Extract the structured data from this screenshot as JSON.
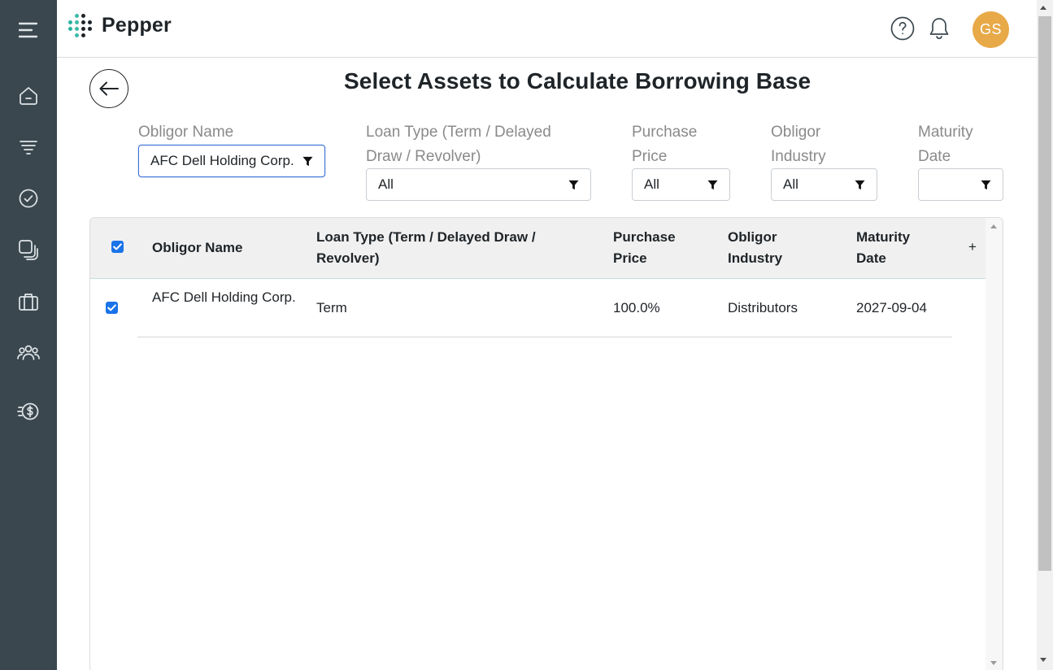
{
  "app": {
    "name": "Pepper",
    "logo_colors": [
      "#2bb3a0",
      "#35c0ad",
      "#1f2428",
      "#1f2428"
    ]
  },
  "header": {
    "avatar_initials": "GS",
    "avatar_color": "#e8a948",
    "help_icon": "question-circle-icon",
    "notifications_icon": "bell-icon"
  },
  "sidebar": {
    "items": [
      {
        "icon": "menu-icon"
      },
      {
        "icon": "home-icon"
      },
      {
        "icon": "funnel-stack-icon"
      },
      {
        "icon": "check-circle-icon"
      },
      {
        "icon": "layers-icon"
      },
      {
        "icon": "briefcase-icon"
      },
      {
        "icon": "users-icon"
      },
      {
        "icon": "dollar-coin-icon"
      }
    ]
  },
  "page": {
    "title": "Select Assets to Calculate Borrowing Base"
  },
  "filters": {
    "obligor_name": {
      "label": "Obligor Name",
      "value": "AFC Dell Holding Corp."
    },
    "loan_type": {
      "label": "Loan Type (Term / Delayed Draw / Revolver)",
      "value": "All"
    },
    "purchase_price": {
      "label": "Purchase Price",
      "value": "All"
    },
    "obligor_industry": {
      "label": "Obligor Industry",
      "value": "All"
    },
    "maturity_date": {
      "label": "Maturity Date",
      "value": ""
    }
  },
  "table": {
    "columns": {
      "obligor_name": "Obligor Name",
      "loan_type": "Loan Type (Term / Delayed Draw / Revolver)",
      "purchase_price": "Purchase Price",
      "obligor_industry": "Obligor Industry",
      "maturity_date": "Maturity Date",
      "add": "+"
    },
    "select_all_checked": true,
    "rows": [
      {
        "checked": true,
        "obligor_name": "AFC Dell Holding Corp.",
        "loan_type": "Term",
        "purchase_price": "100.0%",
        "obligor_industry": "Distributors",
        "maturity_date": "2027-09-04"
      }
    ]
  }
}
